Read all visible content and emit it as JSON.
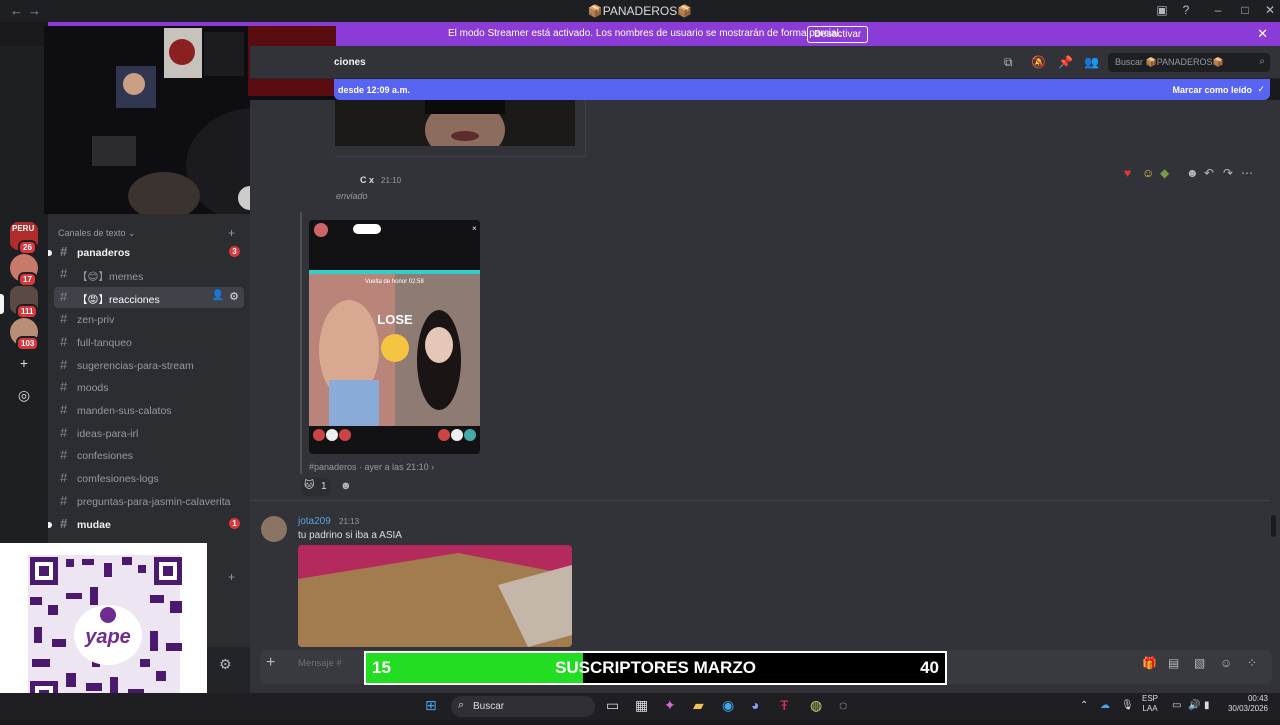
{
  "window": {
    "title": "📦PANADEROS📦",
    "back_icon": "←",
    "forward_icon": "→"
  },
  "streamer_banner": {
    "message": "El modo Streamer está activado. Los nombres de usuario se mostrarán de forma parcial.",
    "deactivate_label": "Desactivar",
    "close_icon": "✕",
    "color": "#8c3cd6"
  },
  "guilds": {
    "badges": [
      "26",
      "17",
      "111",
      "103"
    ],
    "first_label": "PERU"
  },
  "channel_list": {
    "category": "Canales de texto",
    "channels": [
      {
        "label": "panaderos",
        "badge": "3"
      },
      {
        "label": "【😊】memes"
      },
      {
        "label": "【😡】reacciones"
      },
      {
        "label": "zen-priv"
      },
      {
        "label": "full-tanqueo"
      },
      {
        "label": "sugerencias-para-stream"
      },
      {
        "label": "moods"
      },
      {
        "label": "manden-sus-calatos"
      },
      {
        "label": "ideas-para-irl"
      },
      {
        "label": "confesiones"
      },
      {
        "label": "comfesiones-logs"
      },
      {
        "label": "preguntas-para-jasmin-calaverita"
      },
      {
        "label": "mudae",
        "badge": "1"
      }
    ]
  },
  "header": {
    "channel_name": "ciones",
    "search_placeholder": "Buscar 📦PANADEROS📦"
  },
  "new_messages_bar": {
    "left_text": "desde 12:09 a.m.",
    "right_text": "Marcar como leído",
    "color": "#5865f2"
  },
  "messages": [
    {
      "tag": "C x",
      "time": "21:10",
      "text": "enviado",
      "forward_source": "#panaderos",
      "forward_time": "ayer a las 21:10",
      "embed_text": "LOSE",
      "embed_top": "Vuelta de honor  02:58",
      "reaction_count": "1"
    },
    {
      "author": "jota209",
      "time": "21:13",
      "text": "tu padrino si iba a ASIA"
    }
  ],
  "composer": {
    "placeholder": "Mensaje #"
  },
  "subscriber_goal": {
    "current": "15",
    "label": "SUSCRIPTORES MARZO",
    "goal": "40",
    "progress": 0.375,
    "fill_color": "#22dd22"
  },
  "qr_overlay": {
    "brand": "yape"
  },
  "taskbar": {
    "search_placeholder": "Buscar",
    "lang_line1": "ESP",
    "lang_line2": "LAA",
    "time": "00:43",
    "date": "30/03/2026"
  }
}
